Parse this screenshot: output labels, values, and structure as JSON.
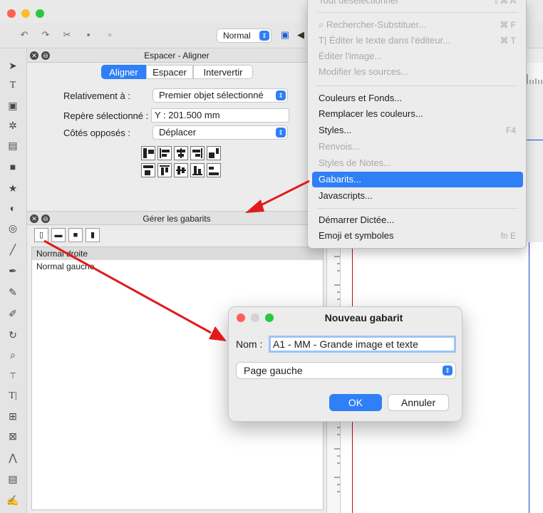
{
  "toolbar": {
    "zoom_value": "Normal"
  },
  "align_panel": {
    "title": "Espacer - Aligner",
    "tabs": [
      "Aligner",
      "Espacer",
      "Intervertir"
    ],
    "relative_label": "Relativement à :",
    "relative_value": "Premier objet sélectionné",
    "marker_label": "Repère sélectionné :",
    "marker_value": "Y : 201.500 mm",
    "opposite_label": "Côtés opposés :",
    "opposite_value": "Déplacer"
  },
  "templates_panel": {
    "title": "Gérer les gabarits",
    "items": [
      "Normal droite",
      "Normal gauche"
    ]
  },
  "menu": {
    "top_item": {
      "label": "Tout désélectionner",
      "shortcut": "⇧⌘ A"
    },
    "items": [
      {
        "label": "Rechercher-Substituer...",
        "shortcut": "⌘ F"
      },
      {
        "label": "Éditer le texte dans l'éditeur...",
        "shortcut": "⌘ T"
      },
      {
        "label": "Éditer l'image...",
        "shortcut": ""
      },
      {
        "label": "Modifier les sources...",
        "shortcut": ""
      },
      {
        "label": "Couleurs et Fonds...",
        "shortcut": ""
      },
      {
        "label": "Remplacer les couleurs...",
        "shortcut": ""
      },
      {
        "label": "Styles...",
        "shortcut": "F4"
      },
      {
        "label": "Renvois...",
        "shortcut": ""
      },
      {
        "label": "Styles de Notes...",
        "shortcut": ""
      },
      {
        "label": "Gabarits...",
        "shortcut": ""
      },
      {
        "label": "Javascripts...",
        "shortcut": ""
      },
      {
        "label": "Démarrer Dictée...",
        "shortcut": ""
      },
      {
        "label": "Emoji et symboles",
        "shortcut": "fn E"
      }
    ]
  },
  "dialog": {
    "title": "Nouveau gabarit",
    "name_label": "Nom :",
    "name_value": "A1 - MM - Grande image et texte",
    "page_value": "Page gauche",
    "ok_label": "OK",
    "cancel_label": "Annuler"
  },
  "colors": {
    "accent": "#2f7ff6",
    "arrow": "#e01b1b",
    "guide_red": "#d0021b",
    "guide_blue": "#1f3fd6"
  }
}
